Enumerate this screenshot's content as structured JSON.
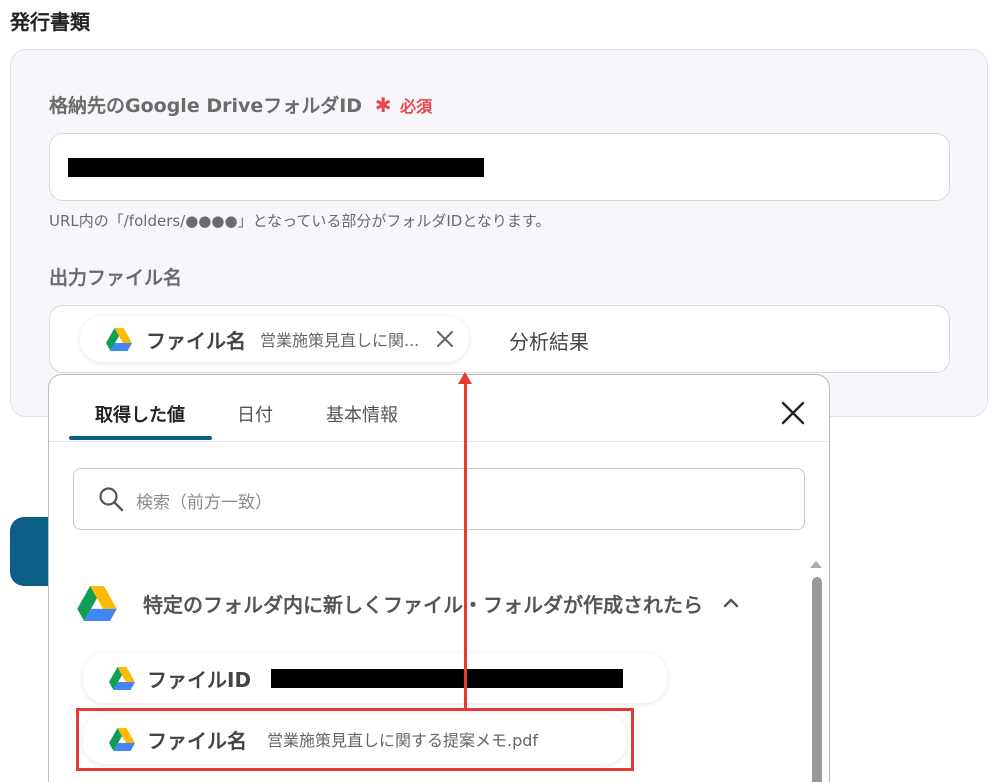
{
  "section": {
    "title": "発行書類"
  },
  "folder_field": {
    "label": "格納先のGoogle DriveフォルダID",
    "required_mark": "✱",
    "required_label": "必須",
    "help": "URL内の「/folders/●●●●」となっている部分がフォルダIDとなります。"
  },
  "output_field": {
    "label": "出力ファイル名",
    "chip": {
      "icon": "google-drive-icon",
      "label": "ファイル名",
      "value": "営業施策見直しに関...",
      "remove_icon": "close-icon"
    },
    "suffix": "分析結果"
  },
  "popover": {
    "tabs": [
      {
        "label": "取得した値",
        "active": true
      },
      {
        "label": "日付",
        "active": false
      },
      {
        "label": "基本情報",
        "active": false
      }
    ],
    "close_icon": "close-icon",
    "search": {
      "icon": "search-icon",
      "placeholder": "検索（前方一致）"
    },
    "group": {
      "icon": "google-drive-icon",
      "title": "特定のフォルダ内に新しくファイル・フォルダが作成されたら",
      "chevron": "chevron-up-icon"
    },
    "items": [
      {
        "icon": "google-drive-icon",
        "label": "ファイルID",
        "value": ""
      },
      {
        "icon": "google-drive-icon",
        "label": "ファイル名",
        "value": "営業施策見直しに関する提案メモ.pdf"
      }
    ]
  },
  "colors": {
    "accent": "#0b5f86",
    "required": "#e5484d",
    "highlight": "#e53935",
    "card_bg": "#f8f6fa"
  }
}
